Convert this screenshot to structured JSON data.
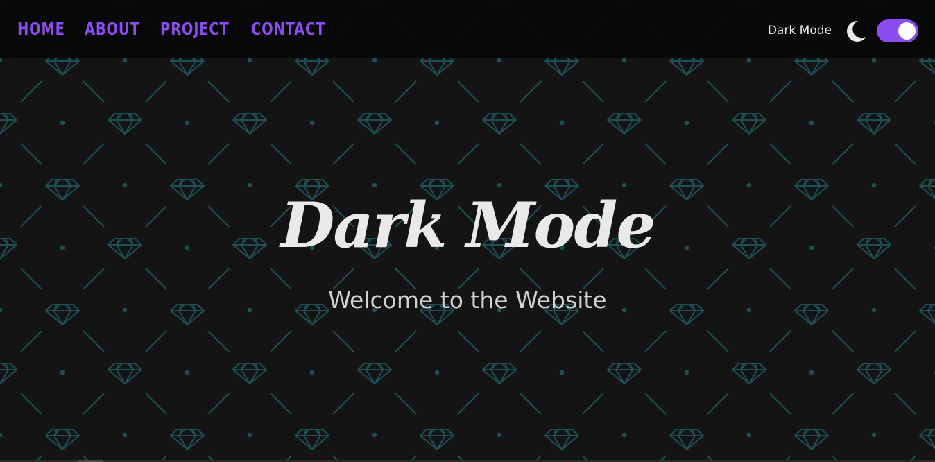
{
  "nav": {
    "items": [
      {
        "label": "HOME"
      },
      {
        "label": "ABOUT"
      },
      {
        "label": "PROJECT"
      },
      {
        "label": "CONTACT"
      }
    ]
  },
  "mode": {
    "label": "Dark Mode",
    "icon": "moon-icon",
    "toggle_on": true
  },
  "hero": {
    "title": "Dark Mode",
    "subtitle": "Welcome to the Website"
  },
  "colors": {
    "background": "#141414",
    "navbar": "#080808",
    "accent": "#8c4df0",
    "pattern": "#1e4f55",
    "text": "#e9e9e9"
  }
}
